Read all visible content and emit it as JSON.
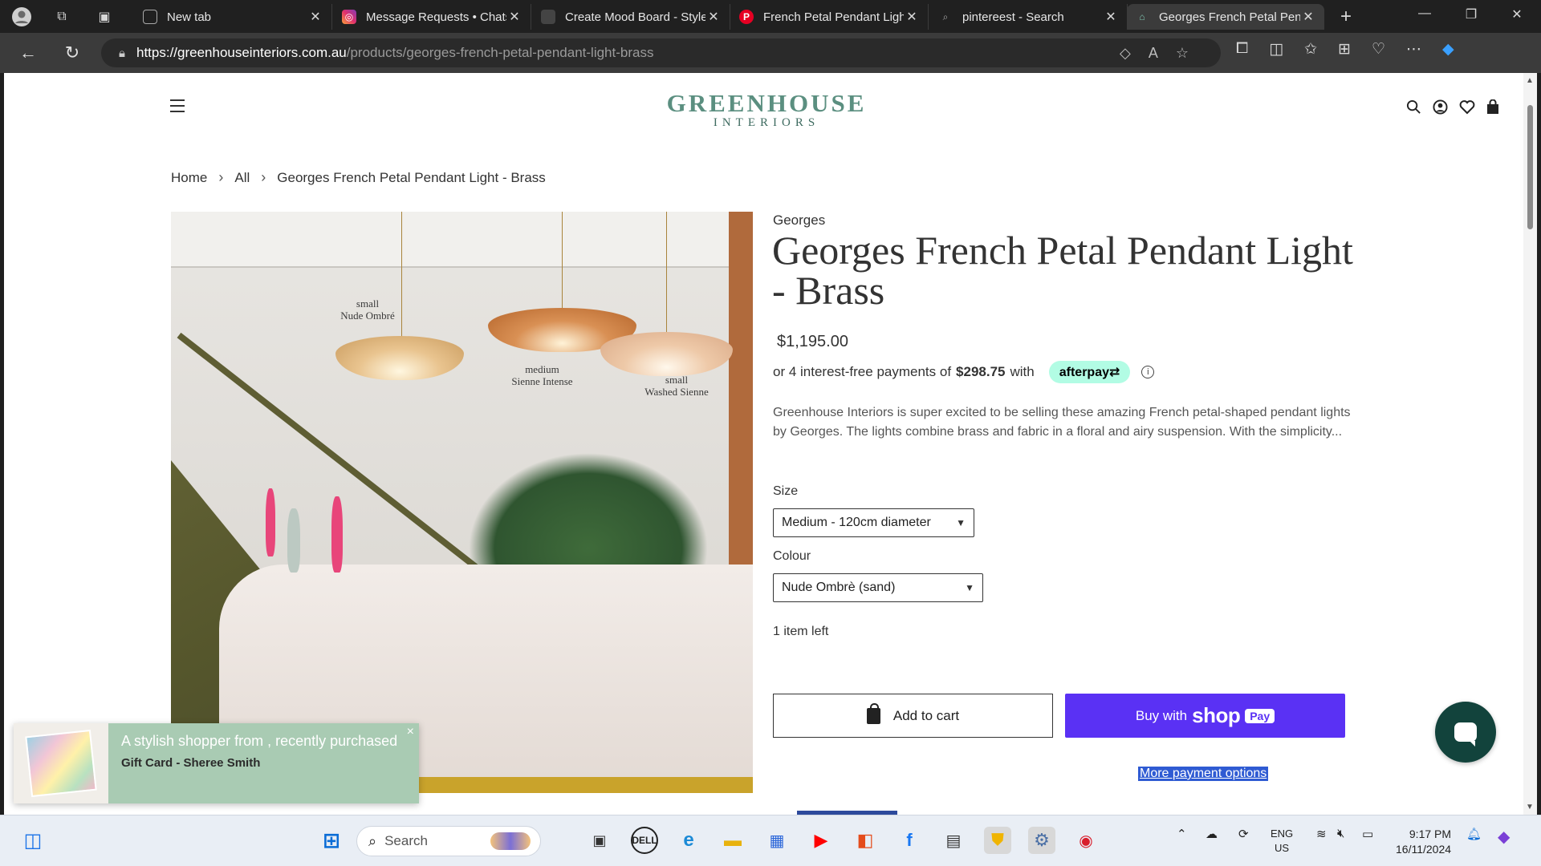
{
  "browser": {
    "tabs": [
      {
        "title": "New tab",
        "favicon": "new-tab-icon",
        "active": false
      },
      {
        "title": "Message Requests • Chats",
        "favicon": "instagram-icon",
        "active": false
      },
      {
        "title": "Create Mood Board - Style",
        "favicon": "site-icon",
        "active": false
      },
      {
        "title": "French Petal Pendant Ligh",
        "favicon": "pinterest-icon",
        "active": false
      },
      {
        "title": "pintereest - Search",
        "favicon": "search-icon",
        "active": false
      },
      {
        "title": "Georges French Petal Pend",
        "favicon": "greenhouse-icon",
        "active": true
      }
    ],
    "url_host": "https://greenhouseinteriors.com.au",
    "url_path": "/products/georges-french-petal-pendant-light-brass"
  },
  "site": {
    "logo_line1": "GREENHOUSE",
    "logo_line2": "INTERIORS",
    "brand_color": "#5b8f80"
  },
  "breadcrumb": {
    "items": [
      "Home",
      "All",
      "Georges French Petal Pendant Light - Brass"
    ]
  },
  "image": {
    "captions": [
      {
        "size": "small",
        "name": "Nude Ombré"
      },
      {
        "size": "medium",
        "name": "Sienne Intense"
      },
      {
        "size": "small",
        "name": "Washed Sienne"
      }
    ]
  },
  "product": {
    "brand": "Georges",
    "title": "Georges French Petal Pendant Light - Brass",
    "price": "$1,195.00",
    "afterpay_prefix": "or 4 interest-free payments of",
    "afterpay_amount": "$298.75",
    "afterpay_suffix": "with",
    "afterpay_badge": "afterpay⇄",
    "description": "Greenhouse Interiors is super excited to be selling these amazing French petal-shaped pendant lights by Georges.      The lights combine brass and fabric in a floral and airy suspension. With the simplicity...",
    "size_label": "Size",
    "size_value": "Medium - 120cm diameter",
    "colour_label": "Colour",
    "colour_value": "Nude Ombrè (sand)",
    "stock": "1 item left",
    "add_to_cart": "Add to cart",
    "buy_with": "Buy with",
    "shop_word": "shop",
    "pay_word": "Pay",
    "more_payment": "More payment options",
    "shop_color": "#5a31f4"
  },
  "toast": {
    "line1": "A stylish shopper from , recently purchased",
    "line2": "Gift Card - Sheree Smith",
    "close": "×"
  },
  "taskbar": {
    "search_label": "Search",
    "lang_line1": "ENG",
    "lang_line2": "US",
    "time": "9:17 PM",
    "date": "16/11/2024"
  }
}
